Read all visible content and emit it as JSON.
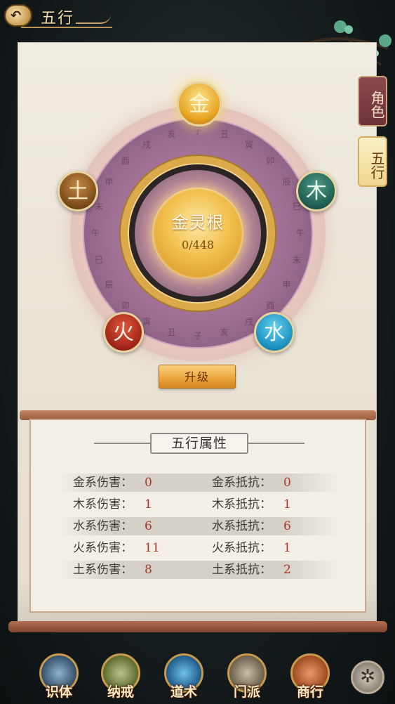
{
  "header": {
    "title": "五行",
    "back_icon": "back-arrow-icon"
  },
  "side_tabs": [
    {
      "label": "角色",
      "active": false
    },
    {
      "label": "五行",
      "active": true
    }
  ],
  "wheel": {
    "core_title": "金灵根",
    "progress_text": "0/448",
    "progress": {
      "current": 0,
      "max": 448
    },
    "elements": {
      "jin": "金",
      "mu": "木",
      "shui": "水",
      "huo": "火",
      "tu": "土"
    },
    "glyphs": [
      "子",
      "丑",
      "寅",
      "卯",
      "辰",
      "巳",
      "午",
      "未",
      "申",
      "酉",
      "戌",
      "亥",
      "子",
      "丑",
      "寅",
      "卯",
      "辰",
      "巳",
      "午",
      "未",
      "申",
      "酉",
      "戌",
      "亥"
    ]
  },
  "upgrade_button": "升级",
  "attributes": {
    "title": "五行属性",
    "rows": [
      {
        "dmg_label": "金系伤害：",
        "dmg": "0",
        "res_label": "金系抵抗：",
        "res": "0"
      },
      {
        "dmg_label": "木系伤害：",
        "dmg": "1",
        "res_label": "木系抵抗：",
        "res": "1"
      },
      {
        "dmg_label": "水系伤害：",
        "dmg": "6",
        "res_label": "水系抵抗：",
        "res": "6"
      },
      {
        "dmg_label": "火系伤害：",
        "dmg": "11",
        "res_label": "火系抵抗：",
        "res": "1"
      },
      {
        "dmg_label": "土系伤害：",
        "dmg": "8",
        "res_label": "土系抵抗：",
        "res": "2"
      }
    ]
  },
  "bottom_nav": [
    {
      "label": "识体",
      "icon": "character-icon"
    },
    {
      "label": "纳戒",
      "icon": "ring-icon"
    },
    {
      "label": "道术",
      "icon": "spell-icon"
    },
    {
      "label": "门派",
      "icon": "sect-icon"
    },
    {
      "label": "商行",
      "icon": "shop-icon"
    }
  ],
  "nav_extra_icon": "pinwheel-icon",
  "colors": {
    "gold": "#e7a420",
    "attr_value": "#a8362a",
    "panel": "#f1ece2"
  }
}
